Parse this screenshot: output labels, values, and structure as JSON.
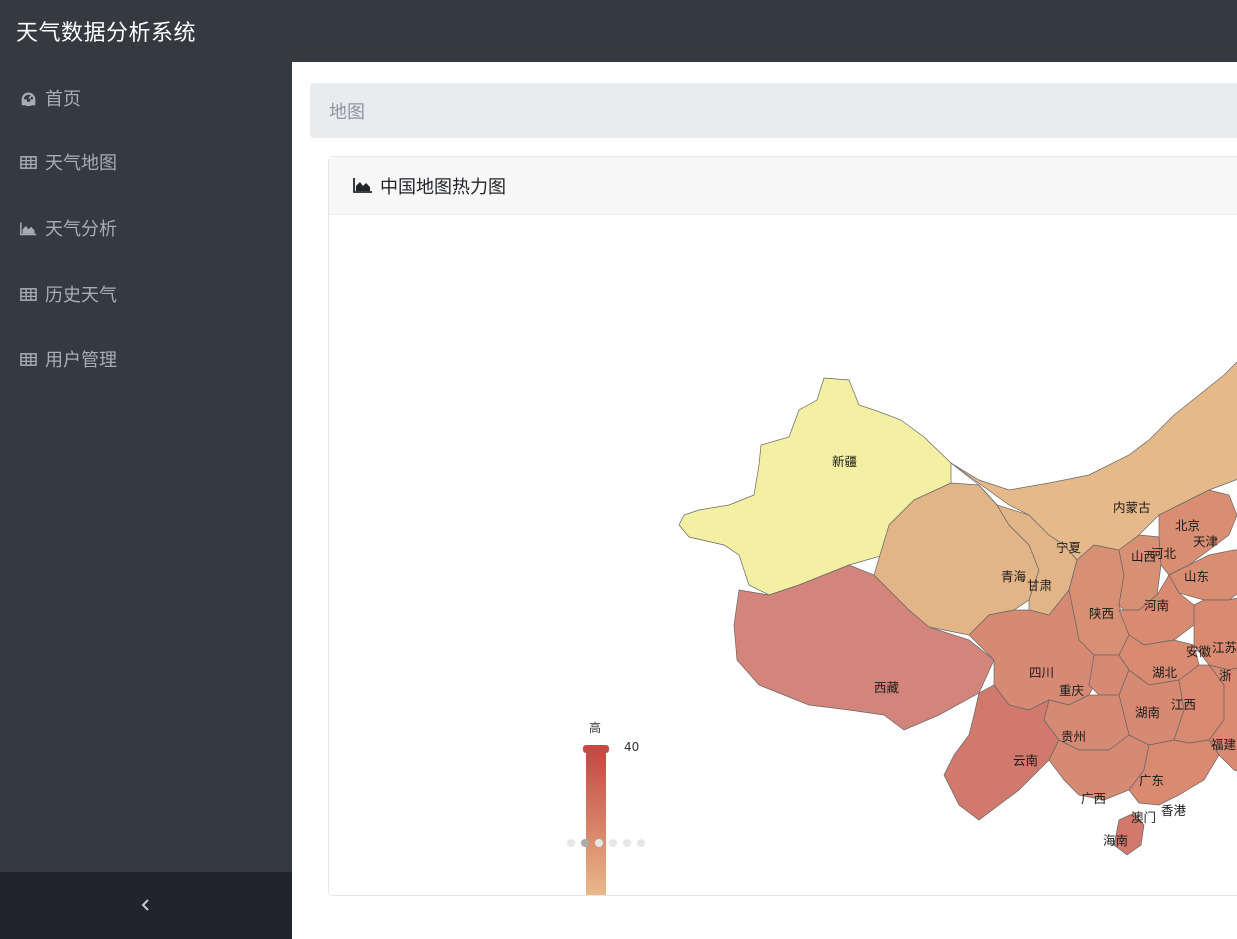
{
  "app": {
    "title": "天气数据分析系统"
  },
  "sidebar": {
    "items": [
      {
        "label": "首页",
        "icon": "dashboard-icon"
      },
      {
        "label": "天气地图",
        "icon": "table-icon"
      },
      {
        "label": "天气分析",
        "icon": "area-chart-icon"
      },
      {
        "label": "历史天气",
        "icon": "table-icon"
      },
      {
        "label": "用户管理",
        "icon": "table-icon"
      }
    ],
    "toggle_icon": "chevron-left-icon"
  },
  "breadcrumb": {
    "label": "地图"
  },
  "card": {
    "title": "中国地图热力图",
    "icon": "area-chart-icon"
  },
  "map": {
    "legend": {
      "high_label": "高",
      "max_value": "40"
    },
    "colors": {
      "low": "#f3f0a3",
      "high": "#c54a44"
    },
    "provinces": [
      {
        "name": "新疆"
      },
      {
        "name": "西藏"
      },
      {
        "name": "青海"
      },
      {
        "name": "甘肃"
      },
      {
        "name": "宁夏"
      },
      {
        "name": "内蒙古"
      },
      {
        "name": "北京"
      },
      {
        "name": "天津"
      },
      {
        "name": "山西"
      },
      {
        "name": "河北"
      },
      {
        "name": "山东"
      },
      {
        "name": "陕西"
      },
      {
        "name": "河南"
      },
      {
        "name": "安徽"
      },
      {
        "name": "江苏"
      },
      {
        "name": "四川"
      },
      {
        "name": "重庆"
      },
      {
        "name": "湖北"
      },
      {
        "name": "浙"
      },
      {
        "name": "湖南"
      },
      {
        "name": "江西"
      },
      {
        "name": "贵州"
      },
      {
        "name": "福建"
      },
      {
        "name": "云南"
      },
      {
        "name": "广西"
      },
      {
        "name": "广东"
      },
      {
        "name": "香港"
      },
      {
        "name": "澳门"
      },
      {
        "name": "海南"
      }
    ]
  }
}
